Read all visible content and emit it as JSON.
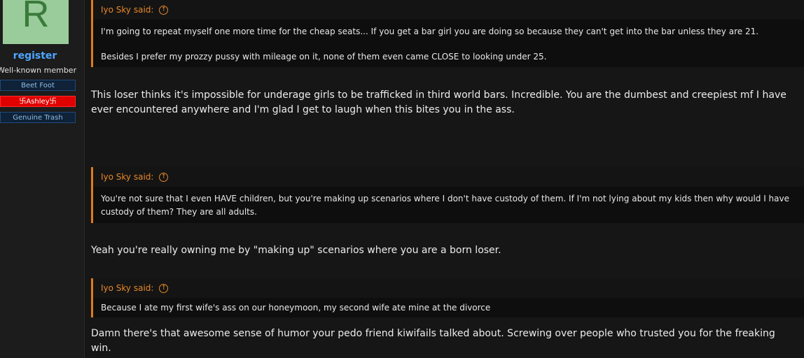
{
  "user": {
    "avatar_letter": "R",
    "username": "register",
    "title": "Well-known member",
    "banners": [
      "Beet Foot",
      "卐Ashley卐",
      "Genuine Trash"
    ]
  },
  "posts": [
    {
      "quote_author": "Iyo Sky said:",
      "quote_lines": [
        "I'm going to repeat myself one more time for the cheap seats... If you get a bar girl you are doing so because they can't get into the bar unless they are 21.",
        "Besides I prefer my prozzy pussy with mileage on it, none of them even came CLOSE to looking under 25."
      ],
      "reply": "This loser thinks it's impossible for underage girls to be trafficked in third world bars. Incredible. You are the dumbest and creepiest mf I have ever encountered anywhere and I'm glad I get to laugh when this bites you in the ass."
    },
    {
      "quote_author": "Iyo Sky said:",
      "quote_lines": [
        "You're not sure that I even HAVE children, but you're making up scenarios where I don't have custody of them. If I'm not lying about my kids then why would I have custody of them? They are all adults."
      ],
      "reply": "Yeah you're really owning me by \"making up\" scenarios where you are a born loser."
    },
    {
      "quote_author": "Iyo Sky said:",
      "quote_lines": [
        "Because I ate my first wife's ass on our honeymoon, my second wife ate mine at the divorce"
      ],
      "reply": "Damn there's that awesome sense of humor your pedo friend kiwifails talked about. Screwing over people who trusted you for the freaking win."
    }
  ],
  "icons": {
    "quote_jump": "arrow-up-circle-icon"
  },
  "colors": {
    "accent": "#e07b1a",
    "username": "#4da6ff",
    "banner_red": "#e00000"
  }
}
